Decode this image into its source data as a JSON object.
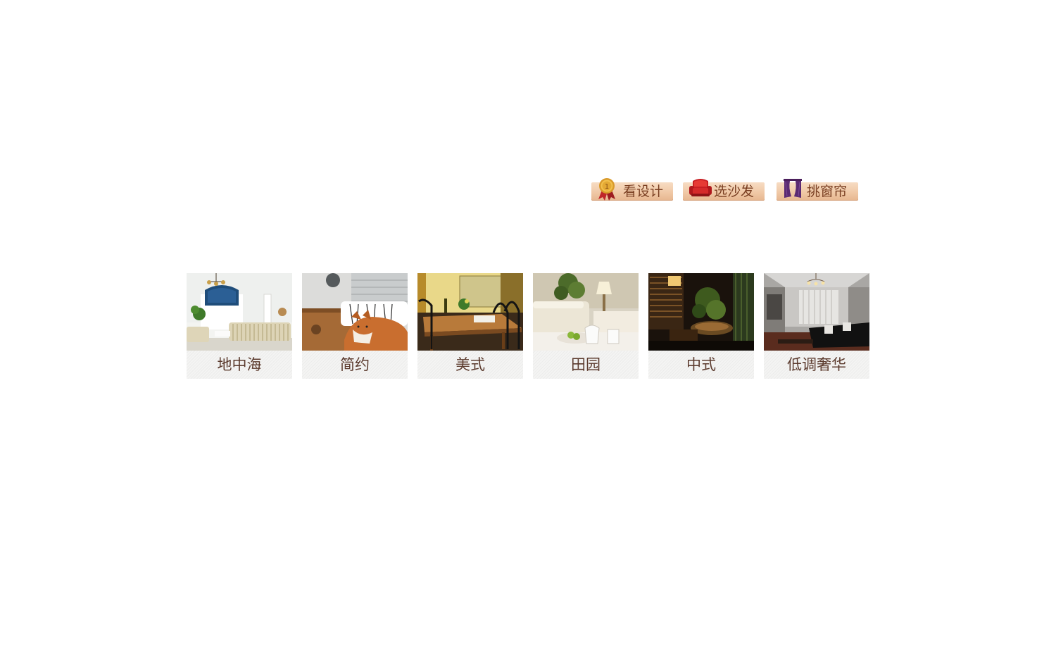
{
  "top_buttons": [
    {
      "label": "看设计",
      "icon": "award-medal-icon"
    },
    {
      "label": "选沙发",
      "icon": "sofa-icon"
    },
    {
      "label": "挑窗帘",
      "icon": "curtain-icon"
    }
  ],
  "styles": [
    {
      "label": "地中海",
      "image": "mediterranean-living-room-photo"
    },
    {
      "label": "简约",
      "image": "minimalist-dog-photo"
    },
    {
      "label": "美式",
      "image": "american-dining-room-photo"
    },
    {
      "label": "田园",
      "image": "pastoral-bedroom-photo"
    },
    {
      "label": "中式",
      "image": "chinese-tea-room-photo"
    },
    {
      "label": "低调奢华",
      "image": "luxury-living-room-photo"
    }
  ],
  "colors": {
    "button_bg": "#f0c9a6",
    "button_text": "#7a3f22",
    "caption_bg": "#f1f1f0",
    "caption_text": "#5b3a2d"
  }
}
